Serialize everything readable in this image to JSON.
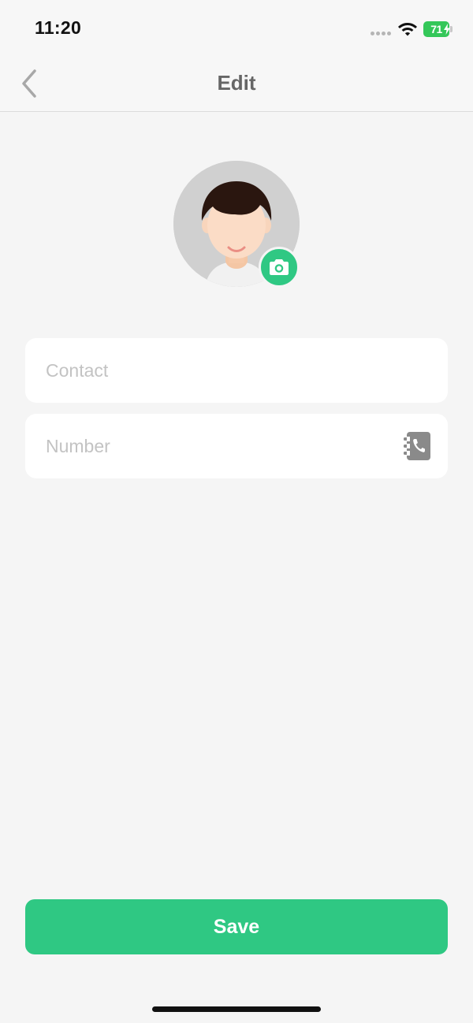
{
  "status_bar": {
    "time": "11:20",
    "battery_level": "71",
    "battery_charging": true,
    "icons": [
      "cellular-dots-icon",
      "wifi-icon",
      "battery-icon"
    ]
  },
  "nav": {
    "title": "Edit",
    "back_icon": "chevron-left-icon"
  },
  "avatar": {
    "icon": "person-avatar-icon",
    "camera_icon": "camera-icon"
  },
  "form": {
    "contact": {
      "value": "",
      "placeholder": "Contact"
    },
    "number": {
      "value": "",
      "placeholder": "Number",
      "trailing_icon": "contacts-book-icon"
    }
  },
  "actions": {
    "save_label": "Save"
  },
  "colors": {
    "accent": "#2fc883",
    "background": "#f5f5f5",
    "battery": "#34c759",
    "placeholder": "#c3c3c3",
    "title": "#666666"
  }
}
